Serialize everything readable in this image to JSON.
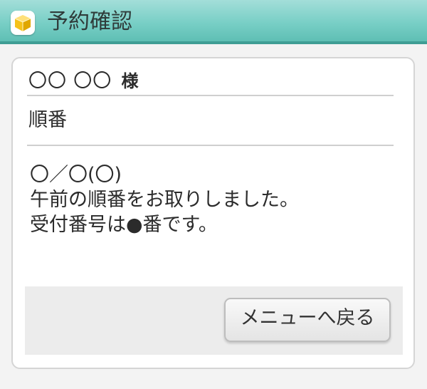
{
  "header": {
    "title": "予約確認",
    "icon": "cube-icon"
  },
  "card": {
    "customer_name": "〇〇 〇〇",
    "honorific": "様",
    "section_label": "順番",
    "message_lines": [
      "〇／〇(〇)",
      "午前の順番をお取りしました。",
      "受付番号は●番です。"
    ]
  },
  "footer": {
    "back_button_label": "メニューへ戻る"
  },
  "colors": {
    "header_top": "#a3ded9",
    "header_bottom": "#5fbfb4",
    "header_border": "#3f9d94",
    "icon_cube": "#f5c21a"
  }
}
